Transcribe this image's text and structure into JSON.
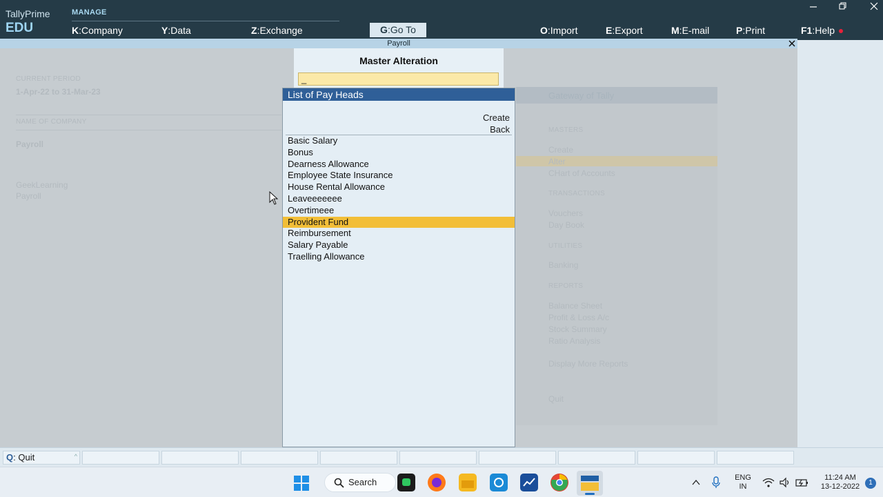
{
  "app": {
    "brand_name": "TallyPrime",
    "edition": "EDU",
    "menu_group": "MANAGE"
  },
  "top_menu": [
    {
      "key": "K",
      "label": "Company"
    },
    {
      "key": "Y",
      "label": "Data"
    },
    {
      "key": "Z",
      "label": "Exchange"
    },
    {
      "key": "G",
      "label": "Go To"
    },
    {
      "key": "O",
      "label": "Import"
    },
    {
      "key": "E",
      "label": "Export"
    },
    {
      "key": "M",
      "label": "E-mail"
    },
    {
      "key": "P",
      "label": "Print"
    },
    {
      "key": "F1",
      "label": "Help"
    }
  ],
  "title_strip": "Payroll",
  "background": {
    "current_period_label": "CURRENT PERIOD",
    "current_period": "1-Apr-22 to 31-Mar-23",
    "name_of_company_label": "NAME OF COMPANY",
    "company": "Payroll",
    "company_list": [
      "GeekLearning",
      "Payroll"
    ],
    "gateway_title": "Gateway of Tally",
    "gateway_sections": [
      {
        "heading": "MASTERS",
        "items": [
          "Create",
          "Alter",
          "CHart of Accounts"
        ]
      },
      {
        "heading": "TRANSACTIONS",
        "items": [
          "Vouchers",
          "Day Book"
        ]
      },
      {
        "heading": "UTILITIES",
        "items": [
          "Banking"
        ]
      },
      {
        "heading": "REPORTS",
        "items": [
          "Balance Sheet",
          "Profit & Loss A/c",
          "Stock Summary",
          "Ratio Analysis"
        ]
      },
      {
        "heading": "",
        "items": [
          "Display More Reports"
        ]
      },
      {
        "heading": "",
        "items": [
          "Quit"
        ]
      }
    ]
  },
  "master_alteration": {
    "title": "Master Alteration",
    "input_value": "_"
  },
  "list_popup": {
    "title": "List of Pay Heads",
    "actions": [
      "Create",
      "Back"
    ],
    "items": [
      "Basic Salary",
      "Bonus",
      "Dearness Allowance",
      "Employee State Insurance",
      "House Rental Allowance",
      "Leaveeeeeee",
      "Overtimeee",
      "Provident Fund",
      "Reimbursement",
      "Salary Payable",
      "Traelling Allowance"
    ],
    "selected_item": "Provident Fund"
  },
  "bottom_bar": {
    "quit_key": "Q",
    "quit_label": "Quit",
    "caret": "^"
  },
  "taskbar": {
    "search_label": "Search",
    "language": "ENG",
    "region": "IN",
    "time": "11:24 AM",
    "date": "13-12-2022",
    "notification_count": "1"
  }
}
